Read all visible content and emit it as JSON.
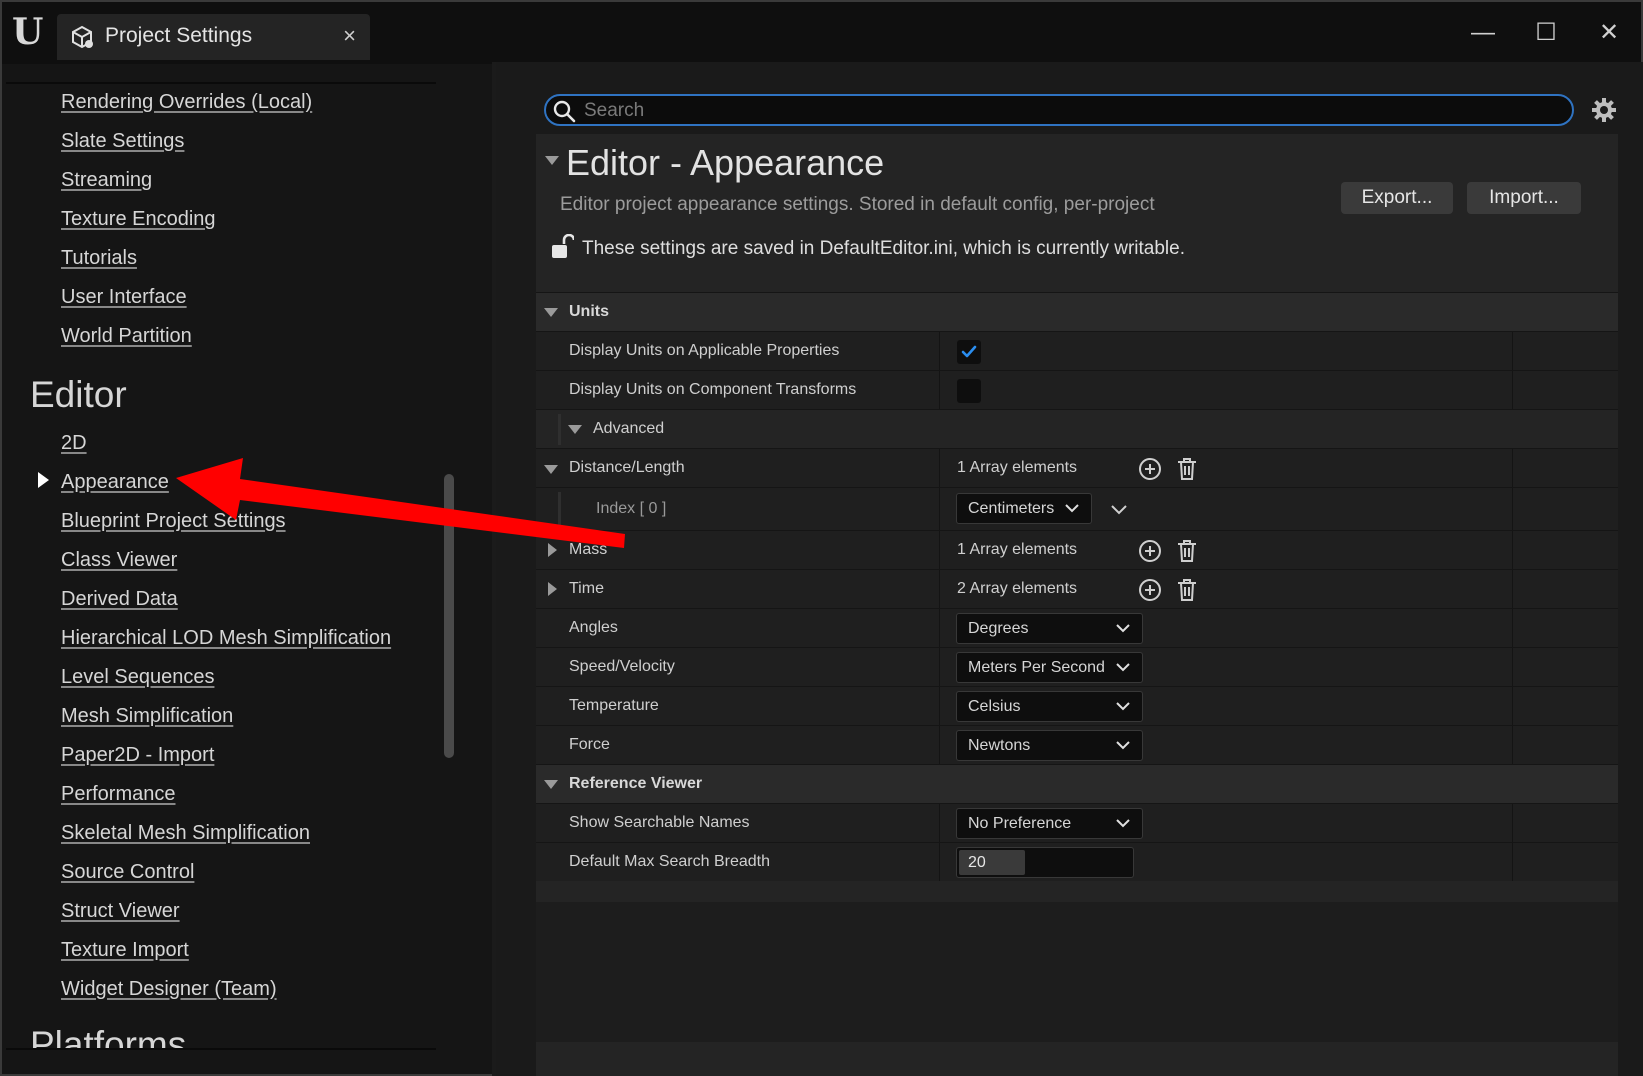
{
  "window": {
    "tab_title": "Project Settings",
    "tab_close": "×",
    "minimize": "—",
    "maximize": "☐",
    "close": "✕",
    "logo": "U"
  },
  "sidebar": {
    "items_top": [
      "Rendering Overrides (Local)",
      "Slate Settings",
      "Streaming",
      "Texture Encoding",
      "Tutorials",
      "User Interface",
      "World Partition"
    ],
    "editor_heading": "Editor",
    "editor_items": [
      "2D",
      "Appearance",
      "Blueprint Project Settings",
      "Class Viewer",
      "Derived Data",
      "Hierarchical LOD Mesh Simplification",
      "Level Sequences",
      "Mesh Simplification",
      "Paper2D - Import",
      "Performance",
      "Skeletal Mesh Simplification",
      "Source Control",
      "Struct Viewer",
      "Texture Import",
      "Widget Designer (Team)"
    ],
    "platforms_heading": "Platforms",
    "selected": "Appearance"
  },
  "search": {
    "placeholder": "Search"
  },
  "header": {
    "title": "Editor - Appearance",
    "subtitle": "Editor project appearance settings. Stored in default config, per-project",
    "export_label": "Export...",
    "import_label": "Import...",
    "lock_text": "These settings are saved in DefaultEditor.ini, which is currently writable."
  },
  "units": {
    "label": "Units",
    "display_units_applicable": {
      "label": "Display Units on Applicable Properties",
      "checked": true
    },
    "display_units_component": {
      "label": "Display Units on Component Transforms",
      "checked": false
    },
    "advanced": "Advanced",
    "distance": {
      "label": "Distance/Length",
      "value": "1 Array elements"
    },
    "index0": {
      "label": "Index [ 0 ]",
      "value": "Centimeters"
    },
    "mass": {
      "label": "Mass",
      "value": "1 Array elements"
    },
    "time": {
      "label": "Time",
      "value": "2 Array elements"
    },
    "angles": {
      "label": "Angles",
      "value": "Degrees"
    },
    "speed": {
      "label": "Speed/Velocity",
      "value": "Meters Per Second"
    },
    "temperature": {
      "label": "Temperature",
      "value": "Celsius"
    },
    "force": {
      "label": "Force",
      "value": "Newtons"
    }
  },
  "reference_viewer": {
    "label": "Reference Viewer",
    "show_names": {
      "label": "Show Searchable Names",
      "value": "No Preference"
    },
    "max_breadth": {
      "label": "Default Max Search Breadth",
      "value": "20"
    }
  },
  "colors": {
    "accent": "#2f73c2",
    "annotation_arrow": "#ff0000",
    "checkbox_tick": "#2b8ef0"
  }
}
